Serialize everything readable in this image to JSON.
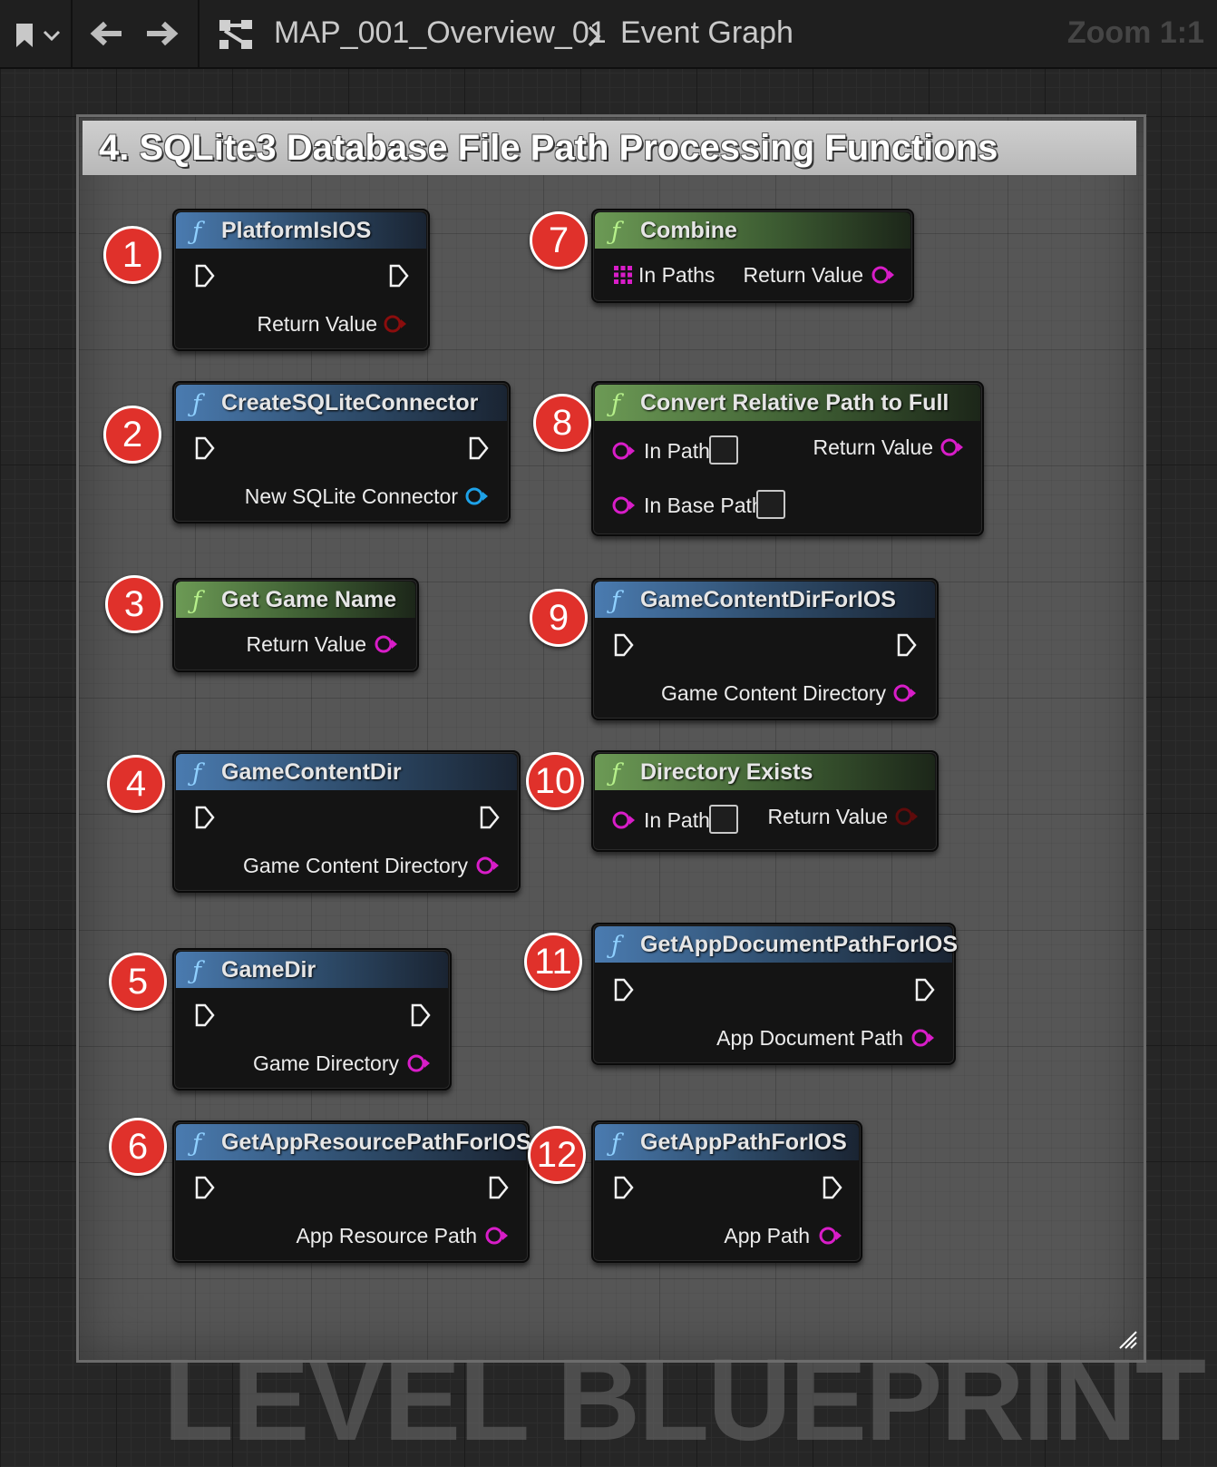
{
  "toolbar": {
    "breadcrumb_map": "MAP_001_Overview_01",
    "breadcrumb_graph": "Event Graph",
    "zoom": "Zoom 1:1"
  },
  "comment": {
    "title": "4. SQLite3 Database File Path Processing Functions"
  },
  "nodes": [
    {
      "badge": "1",
      "title": "PlatformIsIOS",
      "output": "Return Value"
    },
    {
      "badge": "2",
      "title": "CreateSQLiteConnector",
      "output": "New SQLite Connector"
    },
    {
      "badge": "3",
      "title": "Get Game Name",
      "output": "Return Value"
    },
    {
      "badge": "4",
      "title": "GameContentDir",
      "output": "Game Content Directory"
    },
    {
      "badge": "5",
      "title": "GameDir",
      "output": "Game Directory"
    },
    {
      "badge": "6",
      "title": "GetAppResourcePathForIOS",
      "output": "App Resource Path"
    },
    {
      "badge": "7",
      "title": "Combine",
      "input": "In Paths",
      "output": "Return Value"
    },
    {
      "badge": "8",
      "title": "Convert Relative Path to Full",
      "input": "In Path",
      "input2": "In Base Path",
      "output": "Return Value"
    },
    {
      "badge": "9",
      "title": "GameContentDirForIOS",
      "output": "Game Content Directory"
    },
    {
      "badge": "10",
      "title": "Directory Exists",
      "input": "In Path",
      "output": "Return Value"
    },
    {
      "badge": "11",
      "title": "GetAppDocumentPathForIOS",
      "output": "App Document Path"
    },
    {
      "badge": "12",
      "title": "GetAppPathForIOS",
      "output": "App Path"
    }
  ],
  "watermark": "LEVEL BLUEPRINT",
  "colors": {
    "badge": "#e0312b",
    "pin_string": "#d81dc8",
    "pin_bool": "#8a0d0d",
    "pin_object": "#1ea2e8",
    "header_pure": "#6c9a55",
    "header_impure": "#4a7bb0"
  }
}
